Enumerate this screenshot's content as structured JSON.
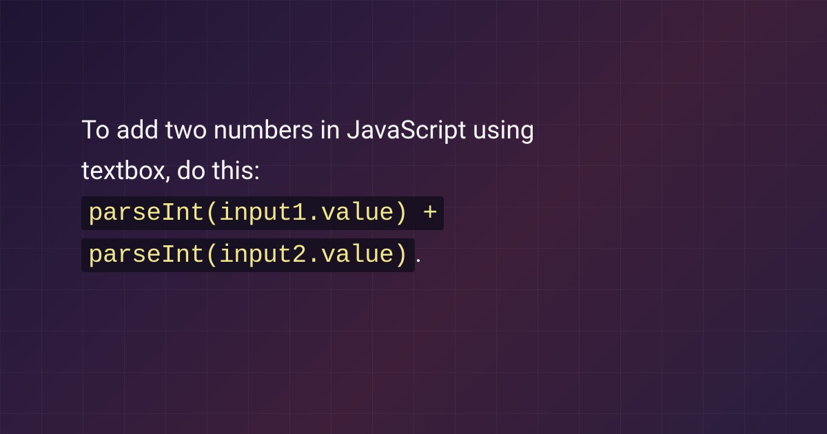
{
  "content": {
    "intro_line1": "To add two numbers in JavaScript using",
    "intro_line2": "textbox, do this:",
    "code_line1": "parseInt(input1.value) +",
    "code_line2": "parseInt(input2.value)",
    "period": "."
  }
}
